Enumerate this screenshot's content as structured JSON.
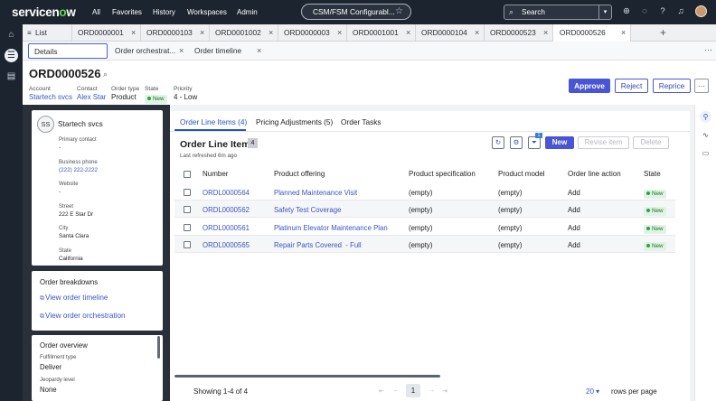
{
  "topnav": {
    "logo": "servicenow",
    "menu": [
      "All",
      "Favorites",
      "History",
      "Workspaces",
      "Admin"
    ],
    "scope": "CSM/FSM Configurabl...",
    "search_placeholder": "Search"
  },
  "tabs": {
    "list_label": "List",
    "items": [
      "ORD0000001",
      "ORD0000103",
      "ORD0001002",
      "ORD0000003",
      "ORD0001001",
      "ORD0000104",
      "ORD0000523",
      "ORD0000526"
    ]
  },
  "subtabs": [
    "Details",
    "Order orchestrat...",
    "Order timeline"
  ],
  "record": {
    "number": "ORD0000526",
    "fields": [
      {
        "label": "Account",
        "value": "Startech svcs"
      },
      {
        "label": "Contact",
        "value": "Alex Star"
      },
      {
        "label": "Order type",
        "value": "Product"
      },
      {
        "label": "State",
        "value": "New"
      },
      {
        "label": "Priority",
        "value": "4 - Low"
      }
    ],
    "actions": {
      "approve": "Approve",
      "reject": "Reject",
      "reprice": "Reprice",
      "more": "···"
    }
  },
  "account_card": {
    "initials": "SS",
    "name": "Startech svcs",
    "primary_contact_label": "Primary contact",
    "primary_contact_value": "-",
    "business_phone_label": "Business phone",
    "business_phone_value": "(222) 222-2222",
    "website_label": "Website",
    "website_value": "-",
    "street_label": "Street",
    "street_value": "222 E Star Dr",
    "city_label": "City",
    "city_value": "Santa Clara",
    "state_label": "State",
    "state_value": "California"
  },
  "breakdowns": {
    "title": "Order breakdowns",
    "timeline_link": "View order timeline",
    "orchestration_link": "View order orchestration"
  },
  "overview": {
    "title": "Order overview",
    "fulfillment_label": "Fulfillment type",
    "fulfillment_value": "Deliver",
    "jeopardy_label": "Jeopardy level",
    "jeopardy_value": "None"
  },
  "main": {
    "tabs": [
      "Order Line Items (4)",
      "Pricing Adjustments (5)",
      "Order Tasks"
    ],
    "list_title": "Order Line Items",
    "count": "4",
    "refreshed": "Last refreshed 6m ago",
    "filter_count": "1",
    "new_btn": "New",
    "revise_btn": "Revise item",
    "delete_btn": "Delete",
    "columns": [
      "Number",
      "Product offering",
      "Product specification",
      "Product model",
      "Order line action",
      "State"
    ],
    "rows": [
      {
        "number": "ORDL0000564",
        "offering": "Planned Maintenance Visit",
        "spec": "(empty)",
        "model": "(empty)",
        "action": "Add",
        "state": "New"
      },
      {
        "number": "ORDL0000562",
        "offering": "Safety Test Coverage",
        "spec": "(empty)",
        "model": "(empty)",
        "action": "Add",
        "state": "New"
      },
      {
        "number": "ORDL0000561",
        "offering": "Platinum Elevator Maintenance Plan",
        "spec": "(empty)",
        "model": "(empty)",
        "action": "Add",
        "state": "New"
      },
      {
        "number": "ORDL0000565",
        "offering": "Repair Parts Covered  - Full",
        "spec": "(empty)",
        "model": "(empty)",
        "action": "Add",
        "state": "New"
      }
    ],
    "showing": "Showing 1-4 of 4",
    "page": "1",
    "rows_per_page_value": "20",
    "rows_per_page_label": "rows per page"
  },
  "colors": {
    "accent": "#4a55d3",
    "nav_bg": "#1c2430",
    "link": "#3a54c4",
    "new_badge": "#dff4e3"
  }
}
